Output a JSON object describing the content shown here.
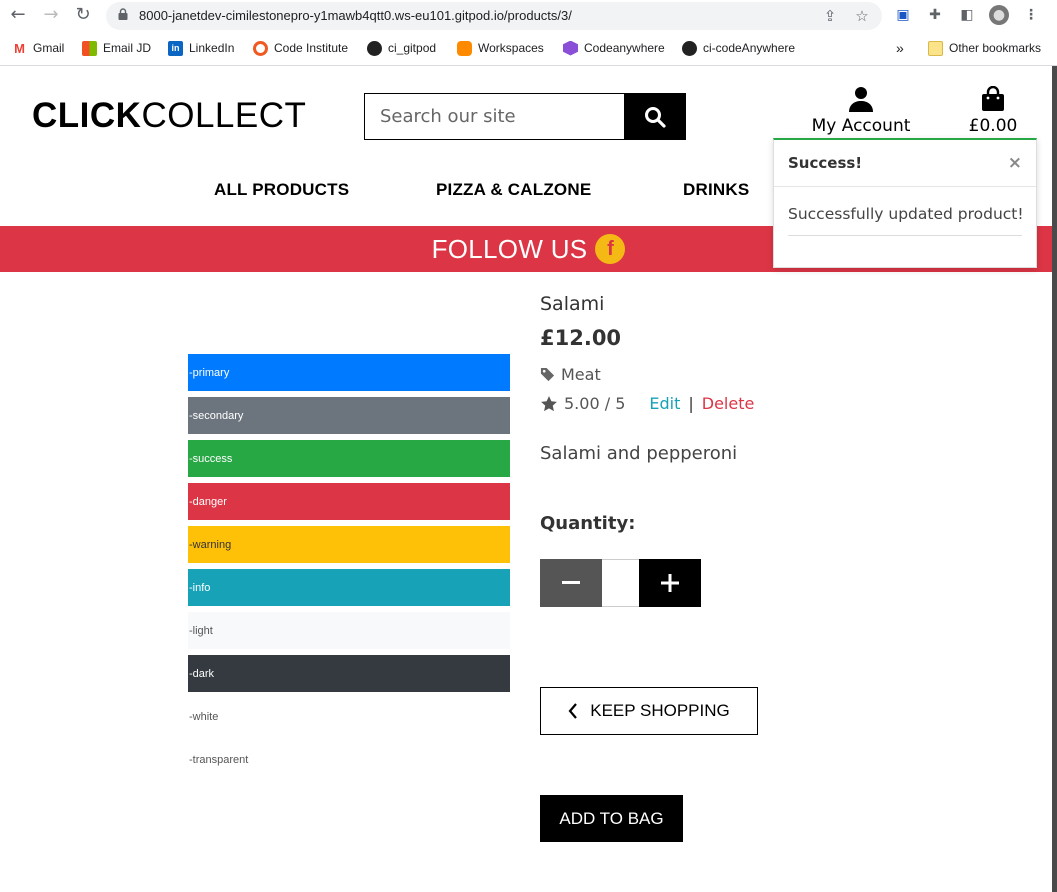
{
  "browser": {
    "url": "8000-janetdev-cimilestonepro-y1mawb4qtt0.ws-eu101.gitpod.io/products/3/",
    "bookmarks": [
      "Gmail",
      "Email JD",
      "LinkedIn",
      "Code Institute",
      "ci_gitpod",
      "Workspaces",
      "Codeanywhere",
      "ci-codeAnywhere"
    ],
    "overflow": "»",
    "other_bookmarks": "Other bookmarks"
  },
  "header": {
    "logo_bold": "CLICK",
    "logo_light": "COLLECT",
    "search_placeholder": "Search our site",
    "account_label": "My Account",
    "bag_total": "£0.00"
  },
  "nav": {
    "items": [
      "ALL PRODUCTS",
      "PIZZA & CALZONE",
      "DRINKS"
    ]
  },
  "banner": {
    "text": "FOLLOW US",
    "icon_letter": "f"
  },
  "toast": {
    "title": "Success!",
    "close": "×",
    "message": "Successfully updated product!",
    "accent": "#28a745"
  },
  "swatches": [
    {
      "label": "-primary",
      "bg": "#007bff",
      "fg": "#ffffff"
    },
    {
      "label": "-secondary",
      "bg": "#6c757d",
      "fg": "#ffffff"
    },
    {
      "label": "-success",
      "bg": "#28a745",
      "fg": "#ffffff"
    },
    {
      "label": "-danger",
      "bg": "#dc3545",
      "fg": "#ffffff"
    },
    {
      "label": "-warning",
      "bg": "#ffc107",
      "fg": "#333333"
    },
    {
      "label": "-info",
      "bg": "#17a2b8",
      "fg": "#ffffff"
    },
    {
      "label": "-light",
      "bg": "#f8f9fa",
      "fg": "#555555"
    },
    {
      "label": "-dark",
      "bg": "#343a40",
      "fg": "#ffffff"
    },
    {
      "label": "-white",
      "bg": "#ffffff",
      "fg": "#555555"
    },
    {
      "label": "-transparent",
      "bg": "transparent",
      "fg": "#555555"
    }
  ],
  "product": {
    "name": "Salami",
    "price": "£12.00",
    "category": "Meat",
    "rating": "5.00 / 5",
    "edit": "Edit",
    "separator": "|",
    "delete": "Delete",
    "description": "Salami and pepperoni",
    "quantity_label": "Quantity:",
    "quantity_value": "",
    "keep_shopping": "KEEP SHOPPING",
    "add_to_bag": "ADD TO BAG"
  },
  "colors": {
    "danger": "#dc3545",
    "info": "#17a2b8",
    "facebook_yellow": "#f5b915"
  }
}
